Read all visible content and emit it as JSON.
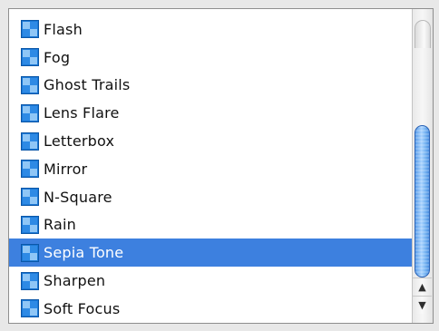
{
  "list": {
    "items": [
      {
        "label": "Flash",
        "icon": "effect-icon"
      },
      {
        "label": "Fog",
        "icon": "effect-icon"
      },
      {
        "label": "Ghost Trails",
        "icon": "effect-icon"
      },
      {
        "label": "Lens Flare",
        "icon": "effect-icon"
      },
      {
        "label": "Letterbox",
        "icon": "effect-icon"
      },
      {
        "label": "Mirror",
        "icon": "effect-icon"
      },
      {
        "label": "N-Square",
        "icon": "effect-icon"
      },
      {
        "label": "Rain",
        "icon": "effect-icon"
      },
      {
        "label": "Sepia Tone",
        "icon": "effect-icon"
      },
      {
        "label": "Sharpen",
        "icon": "effect-icon"
      },
      {
        "label": "Soft Focus",
        "icon": "effect-icon"
      }
    ],
    "selected_label": "Sepia Tone",
    "selection_color": "#3d80df"
  },
  "scrollbar": {
    "up_arrow": "▲",
    "down_arrow": "▼",
    "thumb_color": "#7bb7f3"
  }
}
